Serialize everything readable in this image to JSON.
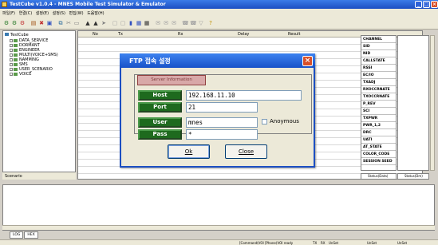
{
  "window": {
    "title": "TestCube v1.0.4 - MNES Mobile Test Simulator & Emulator"
  },
  "menu": [
    "파일(F)",
    "연결(C)",
    "설정(E)",
    "설정(S)",
    "편집(W)",
    "도움말(H)"
  ],
  "tree": {
    "root": "TestCube",
    "items": [
      "DATA_SERVICE",
      "DORMANT",
      "ENGINEER",
      "MULTI(VOICE+SMS)",
      "NAMMING",
      "SMS",
      "USER_SCENARIO",
      "VOICE"
    ]
  },
  "scenario_tab": "Scenario",
  "log_columns": [
    "No",
    "Tx",
    "Rx",
    "Delay",
    "Result"
  ],
  "info_params": [
    "CHANNEL",
    "SID",
    "NID",
    "CALLSTATE",
    "RSSI",
    "EC/IO",
    "TXADJ",
    "RXOCCRNATE",
    "TXOCCRNATE",
    "P_REV",
    "SCI",
    "TXPWR",
    "PWR_1,2",
    "DRC",
    "UATI",
    "AT_STATE",
    "COLOR_CODE",
    "SESSION SEED"
  ],
  "info_tabs": [
    "Status(Data)",
    "Status(Dm)"
  ],
  "sheet_tabs": [
    "LOG",
    "HEX"
  ],
  "statusbar": [
    "[Command(VOI  [Phone(VOI  ready",
    "TX",
    "RX",
    "UnSet",
    "UnSet",
    "UnSet"
  ],
  "dialog": {
    "title": "FTP 접속 설정",
    "section_label": "Server Information",
    "host_label": "Host",
    "host_value": "192.168.11.10",
    "port_label": "Port",
    "port_value": "21",
    "user_label": "User",
    "user_value": "mnes",
    "anonymous_label": "Anoymous",
    "anonymous_checked": false,
    "pass_label": "Pass",
    "pass_value": "*",
    "ok_label": "Ok",
    "close_label": "Close"
  }
}
